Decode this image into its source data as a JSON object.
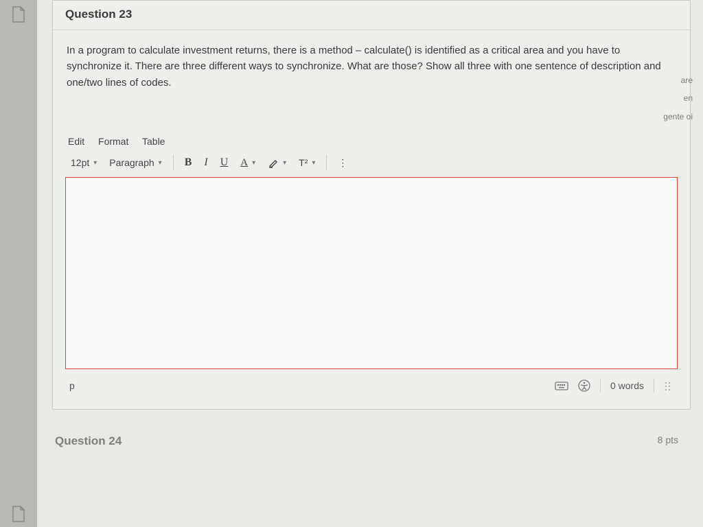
{
  "question": {
    "number_label": "Question 23",
    "prompt": "In a program to calculate investment returns, there is a method – calculate() is identified as a critical area and you have to synchronize it. There are three different ways to synchronize. What are those? Show all three with one sentence of description and one/two lines of codes."
  },
  "side_artifacts": {
    "a": "are",
    "b": "en",
    "c": "gente oi"
  },
  "editor": {
    "menus": {
      "edit": "Edit",
      "format": "Format",
      "table": "Table"
    },
    "font_size": "12pt",
    "block": "Paragraph",
    "buttons": {
      "bold": "B",
      "italic": "I",
      "underline": "U",
      "text_color": "A",
      "highlight": "✎",
      "superscript": "T²",
      "more": "⋮"
    },
    "status": {
      "path": "p",
      "word_count": "0 words"
    }
  },
  "next_question": {
    "label": "Question 24",
    "points": "8 pts"
  }
}
